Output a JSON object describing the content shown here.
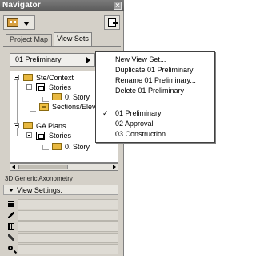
{
  "window": {
    "title": "Navigator"
  },
  "tabs": [
    {
      "label": "Project Map",
      "active": false
    },
    {
      "label": "View Sets",
      "active": true
    }
  ],
  "viewset_dropdown": {
    "selected": "01 Preliminary"
  },
  "tree": {
    "items": [
      {
        "label": "Ste/Context",
        "icon": "folder-icon",
        "level": 0
      },
      {
        "label": "Stories",
        "icon": "layer-icon",
        "level": 1
      },
      {
        "label": "0. Story",
        "icon": "folder-icon",
        "level": 2
      },
      {
        "label": "Sections/Elev",
        "icon": "pencil-icon",
        "level": 1
      },
      {
        "label": "GA Plans",
        "icon": "folder-icon",
        "level": 0
      },
      {
        "label": "Stories",
        "icon": "layer-icon",
        "level": 1
      },
      {
        "label": "0. Story",
        "icon": "folder-icon",
        "level": 2
      }
    ]
  },
  "view_info": {
    "axonometry_label": "3D  Generic Axonometry",
    "view_settings_label": "View Settings:"
  },
  "settings_rows": [
    {
      "icon": "layers-icon"
    },
    {
      "icon": "pen-icon"
    },
    {
      "icon": "grid-icon"
    },
    {
      "icon": "pencil-icon"
    },
    {
      "icon": "magnifier-icon"
    }
  ],
  "context_menu": {
    "actions": [
      "New View Set...",
      "Duplicate 01 Preliminary",
      "Rename 01 Preliminary...",
      "Delete 01 Preliminary"
    ],
    "viewsets": [
      {
        "label": "01 Preliminary",
        "checked": true
      },
      {
        "label": "02 Approval",
        "checked": false
      },
      {
        "label": "03 Construction",
        "checked": false
      }
    ],
    "check_mark": "✓"
  }
}
